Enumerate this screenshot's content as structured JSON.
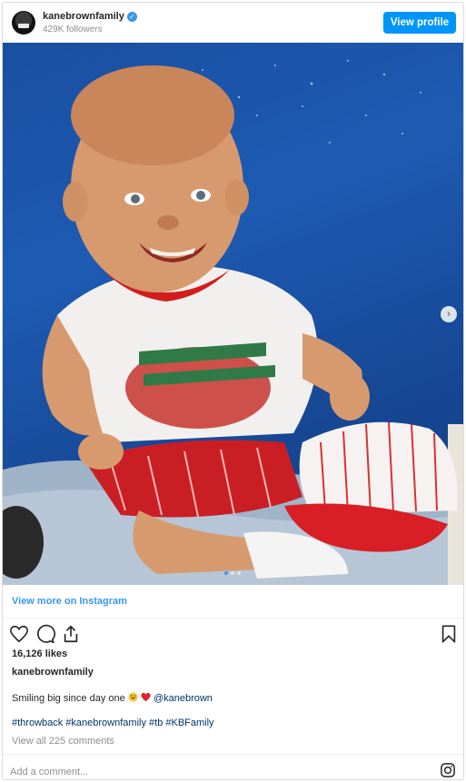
{
  "header": {
    "username": "kanebrownfamily",
    "verified_icon": "verified-badge-icon",
    "followers": "429K followers",
    "view_profile_label": "View profile",
    "accent": "#0095f6"
  },
  "post": {
    "image_icon": "photo-image",
    "carousel": {
      "total": 3,
      "current": 1
    },
    "next_icon": "chevron-right-icon"
  },
  "view_more_label": "View more on Instagram",
  "actions": {
    "like_icon": "heart-icon",
    "comment_icon": "comment-icon",
    "share_icon": "share-icon",
    "save_icon": "bookmark-icon"
  },
  "likes": "16,126 likes",
  "owner": "kanebrownfamily",
  "caption": {
    "text": "Smiling big since day one",
    "emojis": [
      "grinning-face-icon",
      "red-heart-icon"
    ],
    "mention": "@kanebrown"
  },
  "hashtags": "#throwback #kanebrownfamily #tb #KBFamily",
  "view_comments": "View all 225 comments",
  "add_comment_placeholder": "Add a comment...",
  "instagram_icon": "instagram-icon"
}
